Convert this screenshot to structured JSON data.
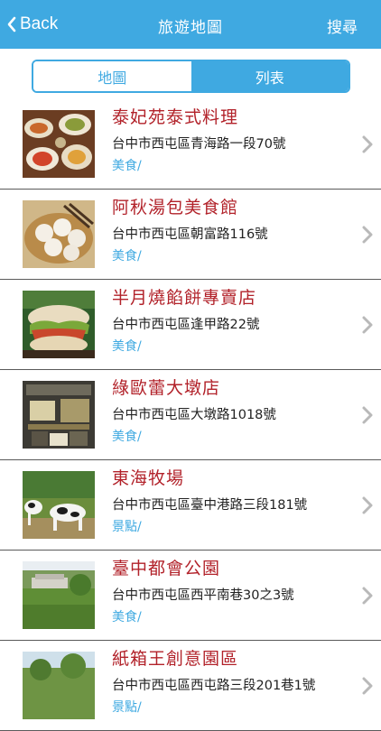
{
  "navbar": {
    "back_label": "Back",
    "title": "旅遊地圖",
    "search_label": "搜尋"
  },
  "segment": {
    "map_label": "地圖",
    "list_label": "列表",
    "selected": "list"
  },
  "colors": {
    "accent": "#3fa9e1",
    "title_red": "#b2222a"
  },
  "places": [
    {
      "name": "泰妃苑泰式料理",
      "address": "台中市西屯區青海路一段70號",
      "category": "美食/",
      "thumbnail": "thai-food-dishes"
    },
    {
      "name": "阿秋湯包美食館",
      "address": "台中市西屯區朝富路116號",
      "category": "美食/",
      "thumbnail": "soup-dumplings"
    },
    {
      "name": "半月燒餡餅專賣店",
      "address": "台中市西屯區逢甲路22號",
      "category": "美食/",
      "thumbnail": "pastry-sandwich"
    },
    {
      "name": "綠歐蕾大墩店",
      "address": "台中市西屯區大墩路1018號",
      "category": "美食/",
      "thumbnail": "shop-interior"
    },
    {
      "name": "東海牧場",
      "address": "台中市西屯區臺中港路三段181號",
      "category": "景點/",
      "thumbnail": "cow-statues"
    },
    {
      "name": "臺中都會公園",
      "address": "台中市西屯區西平南巷30之3號",
      "category": "美食/",
      "thumbnail": "park-building"
    },
    {
      "name": "紙箱王創意園區",
      "address": "台中市西屯區西屯路三段201巷1號",
      "category": "景點/",
      "thumbnail": "park-trees"
    }
  ]
}
